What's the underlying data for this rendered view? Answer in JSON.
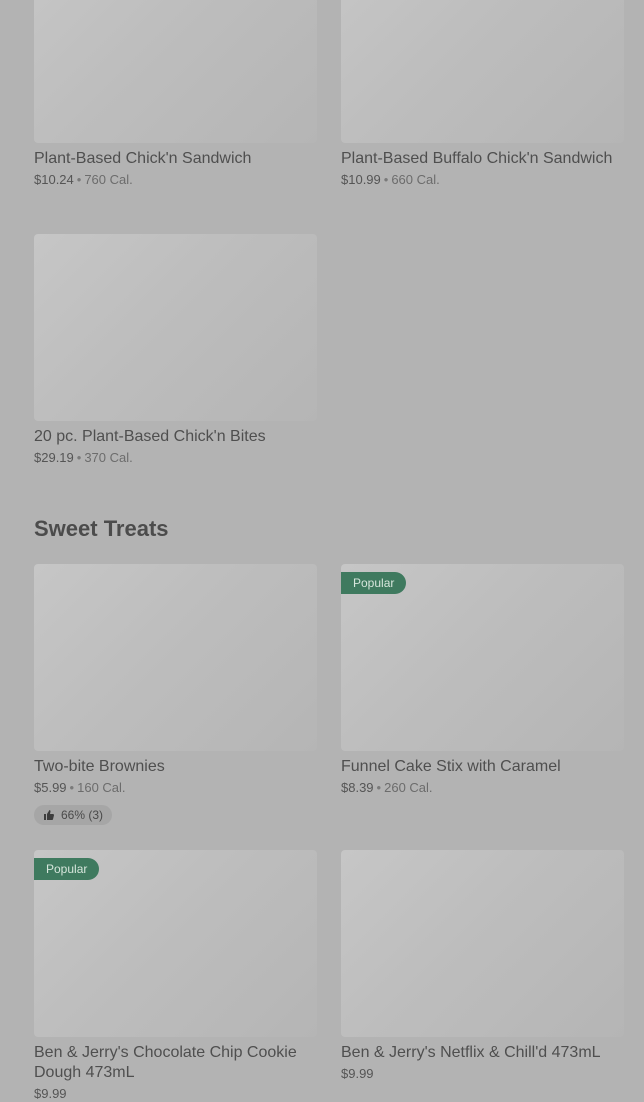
{
  "top_items": [
    {
      "name": "Plant-Based Chick'n Sandwich",
      "price": "$10.24",
      "separator": "•",
      "calories": "760 Cal."
    },
    {
      "name": "Plant-Based Buffalo Chick'n Sandwich",
      "price": "$10.99",
      "separator": "•",
      "calories": "660 Cal."
    },
    {
      "name": "20 pc. Plant-Based Chick'n Bites",
      "price": "$29.19",
      "separator": "•",
      "calories": "370 Cal."
    }
  ],
  "section": {
    "title": "Sweet Treats"
  },
  "sweet_items": [
    {
      "name": "Two-bite Brownies",
      "price": "$5.99",
      "separator": "•",
      "calories": "160 Cal.",
      "rating": "66% (3)"
    },
    {
      "name": "Funnel Cake Stix with Caramel",
      "price": "$8.39",
      "separator": "•",
      "calories": "260 Cal.",
      "badge": "Popular"
    },
    {
      "name": "Ben & Jerry's Chocolate Chip Cookie Dough 473mL",
      "price": "$9.99",
      "badge": "Popular"
    },
    {
      "name": "Ben & Jerry's Netflix & Chill'd 473mL",
      "price": "$9.99"
    }
  ],
  "colors": {
    "background": "#b3b3b3",
    "badge": "#3f7a5f",
    "thumb_icon": "thumbs-up-icon"
  }
}
